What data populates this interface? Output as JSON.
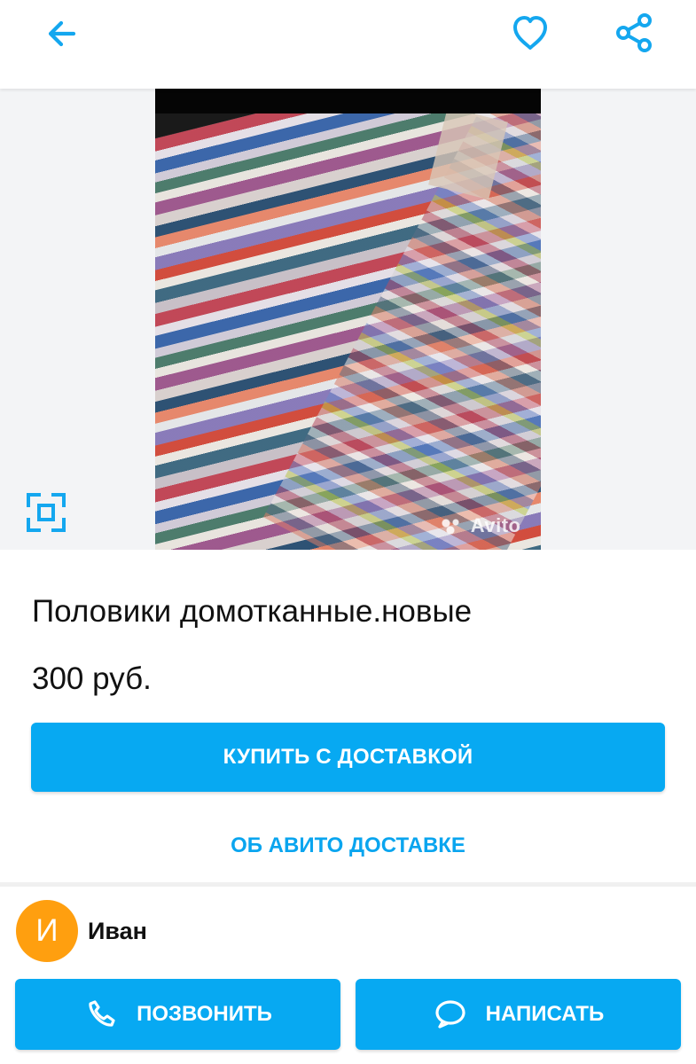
{
  "header": {
    "back_icon": "arrow-left-icon",
    "favorite_icon": "heart-outline-icon",
    "share_icon": "share-icon"
  },
  "gallery": {
    "fullscreen_icon": "fullscreen-icon",
    "watermark": "Avito"
  },
  "listing": {
    "title": "Половики домотканные.новые",
    "price": "300 руб."
  },
  "actions": {
    "buy_delivery_label": "КУПИТЬ С ДОСТАВКОЙ",
    "about_delivery_label": "ОБ АВИТО ДОСТАВКЕ"
  },
  "seller": {
    "avatar_letter": "И",
    "name": "Иван"
  },
  "contact": {
    "call_label": "ПОЗВОНИТЬ",
    "write_label": "НАПИСАТЬ",
    "call_icon": "phone-icon",
    "write_icon": "message-bubble-icon"
  },
  "colors": {
    "accent_blue": "#07a9f2",
    "link_blue": "#0aa5ef",
    "avatar_orange": "#ff9f0f"
  }
}
